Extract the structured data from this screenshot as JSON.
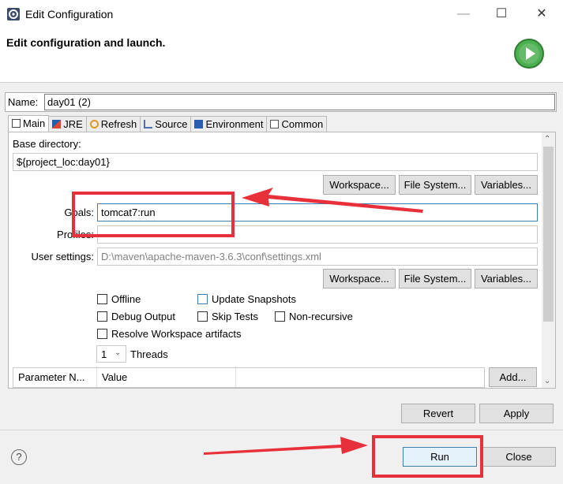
{
  "window": {
    "title": "Edit Configuration",
    "minimize_icon": "minimize-icon",
    "maximize_icon": "maximize-icon",
    "close_icon": "close-icon"
  },
  "header": {
    "title": "Edit configuration and launch."
  },
  "name_field": {
    "label": "Name:",
    "value": "day01 (2)"
  },
  "tabs": [
    {
      "label": "Main",
      "icon": "main-tab-icon",
      "active": true
    },
    {
      "label": "JRE",
      "icon": "jre-icon",
      "active": false
    },
    {
      "label": "Refresh",
      "icon": "refresh-icon",
      "active": false
    },
    {
      "label": "Source",
      "icon": "source-icon",
      "active": false
    },
    {
      "label": "Environment",
      "icon": "environment-icon",
      "active": false
    },
    {
      "label": "Common",
      "icon": "common-icon",
      "active": false
    }
  ],
  "main": {
    "base_directory": {
      "label": "Base directory:",
      "value": "${project_loc:day01}"
    },
    "base_buttons": {
      "workspace": "Workspace...",
      "file_system": "File System...",
      "variables": "Variables..."
    },
    "goals": {
      "label": "Goals:",
      "value": "tomcat7:run"
    },
    "profiles": {
      "label": "Profiles:",
      "value": ""
    },
    "user_settings": {
      "label": "User settings:",
      "value": "D:\\maven\\apache-maven-3.6.3\\conf\\settings.xml"
    },
    "settings_buttons": {
      "workspace": "Workspace...",
      "file_system": "File System...",
      "variables": "Variables..."
    },
    "checkboxes": {
      "offline": "Offline",
      "update_snapshots": "Update Snapshots",
      "debug_output": "Debug Output",
      "skip_tests": "Skip Tests",
      "non_recursive": "Non-recursive",
      "resolve_workspace": "Resolve Workspace artifacts"
    },
    "threads": {
      "value": "1",
      "label": "Threads"
    },
    "param_table": {
      "columns": [
        "Parameter N...",
        "Value"
      ],
      "add_button": "Add..."
    }
  },
  "actions": {
    "revert": "Revert",
    "apply": "Apply"
  },
  "footer": {
    "help": "?",
    "run": "Run",
    "close": "Close"
  },
  "annotation": {
    "color": "#e8303a"
  }
}
